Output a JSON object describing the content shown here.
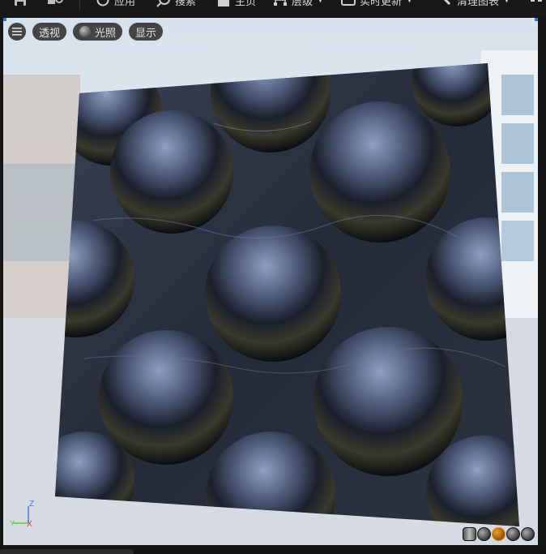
{
  "toolbar": {
    "apply": "应用",
    "search": "搜索",
    "home": "主页",
    "hierarchy": "层级",
    "live_update": "实时更新",
    "clean_graph": "清理图表"
  },
  "viewport": {
    "menu_icon": "hamburger-icon",
    "perspective_label": "透视",
    "lit_label": "光照",
    "show_label": "显示",
    "axis": {
      "x": "X",
      "y": "Y",
      "z": "Z"
    },
    "axis_colors": {
      "x": "#e0303a",
      "y": "#4ccf3c",
      "z": "#3a7ae8"
    },
    "preview_shapes": [
      "cylinder-icon",
      "sphere-icon",
      "plane-icon",
      "cube-icon",
      "custom-mesh-icon"
    ],
    "active_preview": "plane-icon",
    "accent": "#e08a10"
  }
}
